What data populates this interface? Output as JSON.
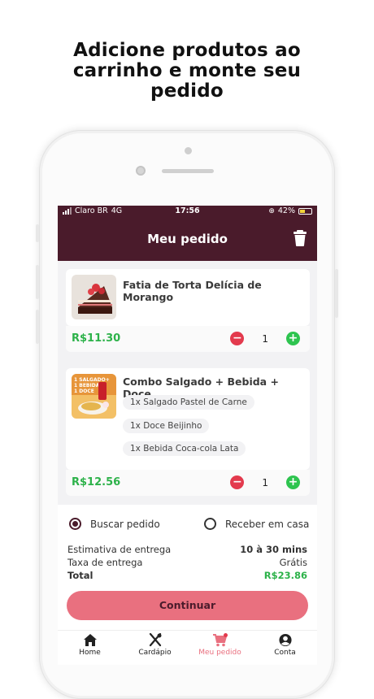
{
  "headline": [
    "Adicione produtos ao",
    "carrinho e monte seu",
    "pedido"
  ],
  "status_bar": {
    "carrier": "Claro BR",
    "network": "4G",
    "time": "17:56",
    "battery": "42%"
  },
  "header": {
    "title": "Meu pedido",
    "action_icon": "trash-icon"
  },
  "items": [
    {
      "name": "Fatia de Torta Delícia de Morango",
      "price": "R$11.30",
      "quantity": "1",
      "details": []
    },
    {
      "name": "Combo Salgado + Bebida + Doce",
      "price": "R$12.56",
      "quantity": "1",
      "details": [
        "1x Salgado Pastel de Carne",
        "1x Doce Beijinho",
        "1x Bebida Coca-cola Lata"
      ]
    }
  ],
  "delivery_options": [
    {
      "label": "Buscar pedido",
      "selected": true
    },
    {
      "label": "Receber em casa",
      "selected": false
    }
  ],
  "summary": {
    "estimate_label": "Estimativa de entrega",
    "estimate_value": "10 à 30 mins",
    "fee_label": "Taxa de entrega",
    "fee_value": "Grátis",
    "total_label": "Total",
    "total_value": "R$23.86"
  },
  "continue_label": "Continuar",
  "tabs": [
    {
      "label": "Home",
      "icon": "home-icon",
      "active": false
    },
    {
      "label": "Cardápio",
      "icon": "utensils-icon",
      "active": false
    },
    {
      "label": "Meu pedido",
      "icon": "cart-icon",
      "active": true
    },
    {
      "label": "Conta",
      "icon": "user-icon",
      "active": false
    }
  ],
  "colors": {
    "brand": "#4a1b2b",
    "accent": "#e9707f",
    "price_green": "#2db24a",
    "minus_red": "#e33a4d",
    "plus_green": "#2ec44f"
  }
}
